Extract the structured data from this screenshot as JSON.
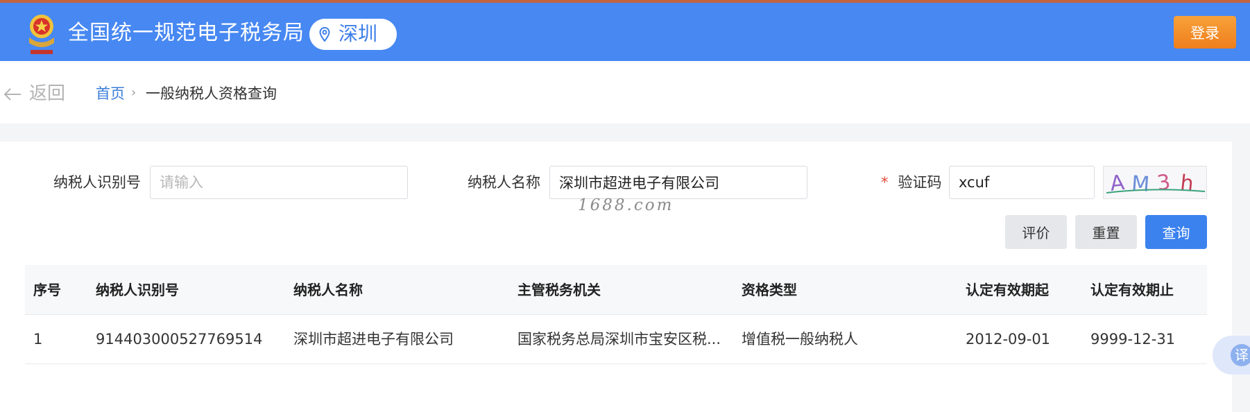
{
  "header": {
    "brand_title": "全国统一规范电子税务局",
    "city": "深圳",
    "login_label": "登录"
  },
  "nav": {
    "back_label": "返回",
    "home_label": "首页",
    "separator": "›",
    "current_page": "一般纳税人资格查询"
  },
  "form": {
    "taxpayer_id_label": "纳税人识别号",
    "taxpayer_id_placeholder": "请输入",
    "taxpayer_id_value": "",
    "taxpayer_name_label": "纳税人名称",
    "taxpayer_name_value": "深圳市超进电子有限公司",
    "captcha_required_mark": "*",
    "captcha_label": "验证码",
    "captcha_value": "xcuf",
    "captcha_image_text": "AM3h"
  },
  "watermark": "1688.com",
  "buttons": {
    "evaluate": "评价",
    "reset": "重置",
    "query": "查询"
  },
  "table": {
    "columns": [
      "序号",
      "纳税人识别号",
      "纳税人名称",
      "主管税务机关",
      "资格类型",
      "认定有效期起",
      "认定有效期止"
    ],
    "rows": [
      [
        "1",
        "914403000527769514",
        "深圳市超进电子有限公司",
        "国家税务总局深圳市宝安区税...",
        "增值税一般纳税人",
        "2012-09-01",
        "9999-12-31"
      ]
    ]
  },
  "translate_label": "译",
  "colors": {
    "header_blue": "#4788f2",
    "login_orange": "#f08a26",
    "query_blue": "#3b82ee",
    "required_red": "#e24b3b"
  },
  "icons": {
    "emblem": "national-tax-emblem",
    "location": "map-pin-icon",
    "back": "arrow-left-icon",
    "translate": "translate-icon"
  }
}
